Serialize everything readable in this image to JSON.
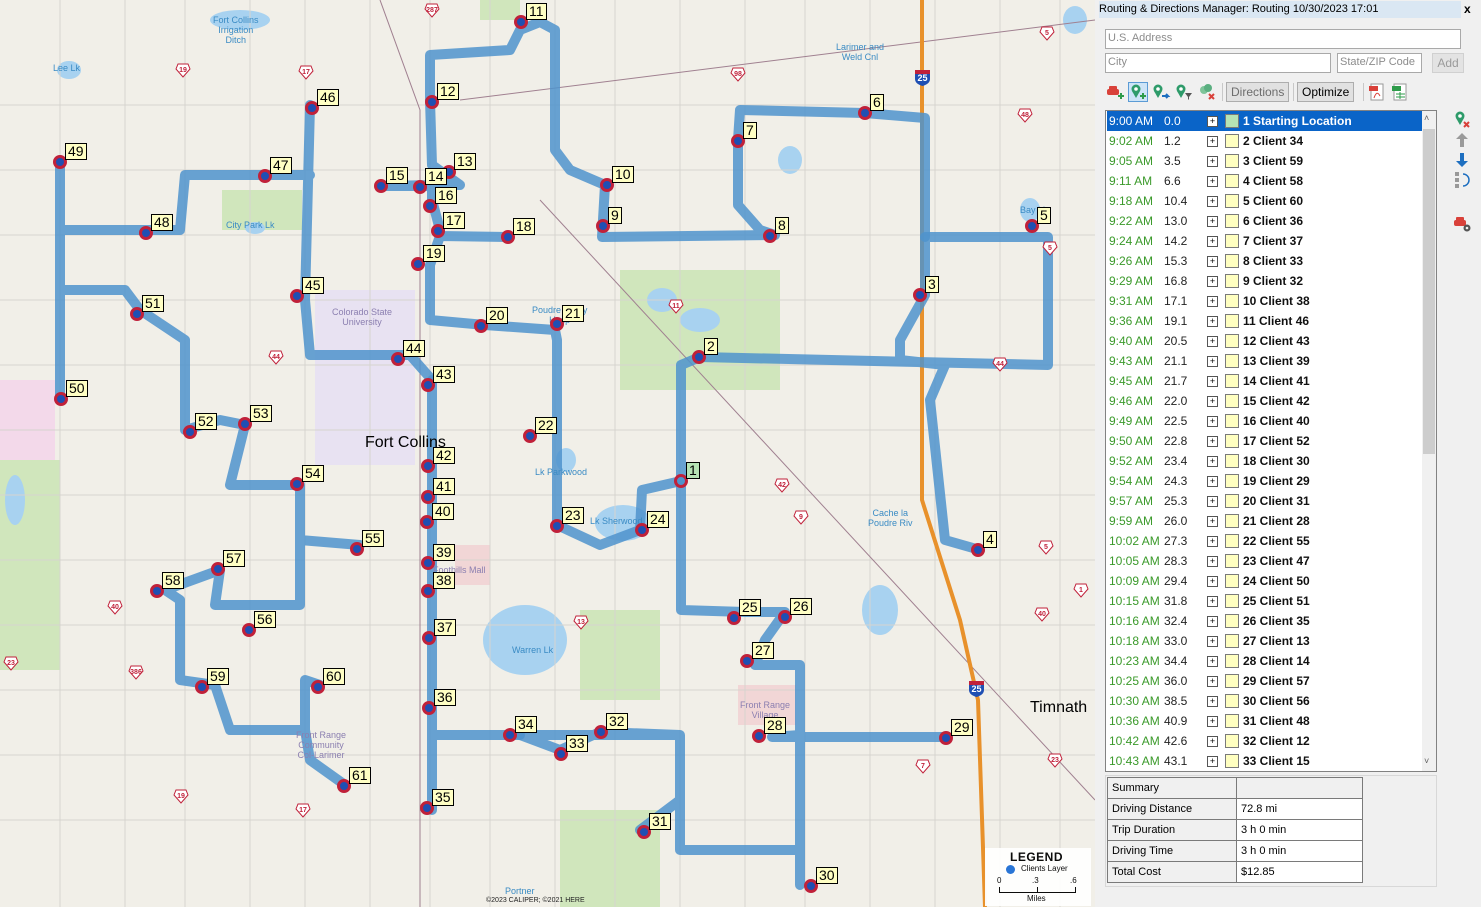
{
  "panel": {
    "title": "Routing & Directions Manager: Routing 10/30/2023 17:01",
    "close_label": "x",
    "address_placeholder": "U.S. Address",
    "city_placeholder": "City",
    "statezip_placeholder": "State/ZIP Code",
    "add_label": "Add",
    "toolbar": {
      "icons": [
        "add-vehicle-icon",
        "add-stop-icon",
        "route-stop-icon",
        "filter-stops-icon",
        "remove-stops-icon"
      ],
      "directions_label": "Directions",
      "optimize_label": "Optimize",
      "export_icons": [
        "pdf-export-icon",
        "excel-export-icon"
      ]
    },
    "side_icons": [
      "delete-stop-icon",
      "move-up-icon",
      "move-down-icon",
      "reverse-order-icon",
      "vehicle-settings-icon"
    ],
    "stops": [
      {
        "time": "9:00 AM",
        "dist": "0.0",
        "name": "1 Starting Location",
        "selected": true
      },
      {
        "time": "9:02 AM",
        "dist": "1.2",
        "name": "2 Client 34"
      },
      {
        "time": "9:05 AM",
        "dist": "3.5",
        "name": "3 Client 59"
      },
      {
        "time": "9:11 AM",
        "dist": "6.6",
        "name": "4 Client 58"
      },
      {
        "time": "9:18 AM",
        "dist": "10.4",
        "name": "5 Client 60"
      },
      {
        "time": "9:22 AM",
        "dist": "13.0",
        "name": "6 Client 36"
      },
      {
        "time": "9:24 AM",
        "dist": "14.2",
        "name": "7 Client 37"
      },
      {
        "time": "9:26 AM",
        "dist": "15.3",
        "name": "8 Client 33"
      },
      {
        "time": "9:29 AM",
        "dist": "16.8",
        "name": "9 Client 32"
      },
      {
        "time": "9:31 AM",
        "dist": "17.1",
        "name": "10 Client 38"
      },
      {
        "time": "9:36 AM",
        "dist": "19.1",
        "name": "11 Client 46"
      },
      {
        "time": "9:40 AM",
        "dist": "20.5",
        "name": "12 Client 43"
      },
      {
        "time": "9:43 AM",
        "dist": "21.1",
        "name": "13 Client 39"
      },
      {
        "time": "9:45 AM",
        "dist": "21.7",
        "name": "14 Client 41"
      },
      {
        "time": "9:46 AM",
        "dist": "22.0",
        "name": "15 Client 42"
      },
      {
        "time": "9:49 AM",
        "dist": "22.5",
        "name": "16 Client 40"
      },
      {
        "time": "9:50 AM",
        "dist": "22.8",
        "name": "17 Client 52"
      },
      {
        "time": "9:52 AM",
        "dist": "23.4",
        "name": "18 Client 30"
      },
      {
        "time": "9:54 AM",
        "dist": "24.3",
        "name": "19 Client 29"
      },
      {
        "time": "9:57 AM",
        "dist": "25.3",
        "name": "20 Client 31"
      },
      {
        "time": "9:59 AM",
        "dist": "26.0",
        "name": "21 Client 28"
      },
      {
        "time": "10:02 AM",
        "dist": "27.3",
        "name": "22 Client 55"
      },
      {
        "time": "10:05 AM",
        "dist": "28.3",
        "name": "23 Client 47"
      },
      {
        "time": "10:09 AM",
        "dist": "29.4",
        "name": "24 Client 50"
      },
      {
        "time": "10:15 AM",
        "dist": "31.8",
        "name": "25 Client 51"
      },
      {
        "time": "10:16 AM",
        "dist": "32.4",
        "name": "26 Client 35"
      },
      {
        "time": "10:18 AM",
        "dist": "33.0",
        "name": "27 Client 13"
      },
      {
        "time": "10:23 AM",
        "dist": "34.4",
        "name": "28 Client 14"
      },
      {
        "time": "10:25 AM",
        "dist": "36.0",
        "name": "29 Client 57"
      },
      {
        "time": "10:30 AM",
        "dist": "38.5",
        "name": "30 Client 56"
      },
      {
        "time": "10:36 AM",
        "dist": "40.9",
        "name": "31 Client 48"
      },
      {
        "time": "10:42 AM",
        "dist": "42.6",
        "name": "32 Client 12"
      },
      {
        "time": "10:43 AM",
        "dist": "43.1",
        "name": "33 Client 15"
      }
    ],
    "summary": {
      "header": "Summary",
      "rows": [
        {
          "label": "Driving Distance",
          "value": "72.8 mi"
        },
        {
          "label": "Trip Duration",
          "value": "3 h 0 min"
        },
        {
          "label": "Driving Time",
          "value": "3 h 0 min"
        },
        {
          "label": "Total Cost",
          "value": "$12.85"
        }
      ]
    }
  },
  "map": {
    "colors": {
      "route": "#4f93cc",
      "stop_fill": "#1f4fb3",
      "stop_ring": "#c0213a",
      "label_bg": "#ffffc4",
      "start_label_bg": "#b6e3b4",
      "interstate": "#e8912b"
    },
    "place_labels": [
      {
        "text": "Fort Collins\nIrrigation\nDitch",
        "kind": "water"
      },
      {
        "text": "Lee Lk",
        "kind": "water"
      },
      {
        "text": "Larimer and\nWeld Cnl",
        "kind": "water"
      },
      {
        "text": "City Park Lk",
        "kind": "water"
      },
      {
        "text": "Colorado State\nUniversity",
        "kind": "poi"
      },
      {
        "text": "Poudre Valley\nHosp",
        "kind": "water"
      },
      {
        "text": "Fort Collins",
        "kind": "city"
      },
      {
        "text": "Lk Parkwood",
        "kind": "water"
      },
      {
        "text": "Lk Sherwood",
        "kind": "water"
      },
      {
        "text": "Foothills Mall",
        "kind": "poi"
      },
      {
        "text": "Warren Lk",
        "kind": "water"
      },
      {
        "text": "Cache la\nPoudre Riv",
        "kind": "water"
      },
      {
        "text": "Front Range\nVillage",
        "kind": "poi"
      },
      {
        "text": "Front Range\nCommunity\nCol-Larimer",
        "kind": "poi"
      },
      {
        "text": "Timnath",
        "kind": "city"
      },
      {
        "text": "Portner",
        "kind": "water"
      },
      {
        "text": "Bay Lk",
        "kind": "water"
      }
    ],
    "shields": [
      "287",
      "19",
      "17",
      "98",
      "5",
      "48",
      "11",
      "44",
      "42",
      "9",
      "40",
      "13",
      "386",
      "23",
      "7",
      "19",
      "17",
      "5",
      "5",
      "40",
      "44",
      "1",
      "23"
    ],
    "interstate_label": "25",
    "stop_labels": [
      "1",
      "2",
      "3",
      "4",
      "5",
      "6",
      "7",
      "8",
      "9",
      "10",
      "11",
      "12",
      "13",
      "14",
      "15",
      "16",
      "17",
      "18",
      "19",
      "20",
      "21",
      "22",
      "23",
      "24",
      "25",
      "26",
      "27",
      "28",
      "29",
      "30",
      "31",
      "32",
      "33",
      "34",
      "35",
      "36",
      "37",
      "38",
      "39",
      "40",
      "41",
      "42",
      "43",
      "44",
      "45",
      "46",
      "47",
      "48",
      "49",
      "50",
      "51",
      "52",
      "53",
      "54",
      "55",
      "56",
      "57",
      "58",
      "59",
      "60",
      "61"
    ],
    "legend": {
      "title": "LEGEND",
      "layer": "Clients Layer",
      "ticks": [
        "0",
        ".3",
        ".6"
      ],
      "units": "Miles"
    },
    "copyright": "©2023 CALIPER; ©2021 HERE"
  }
}
